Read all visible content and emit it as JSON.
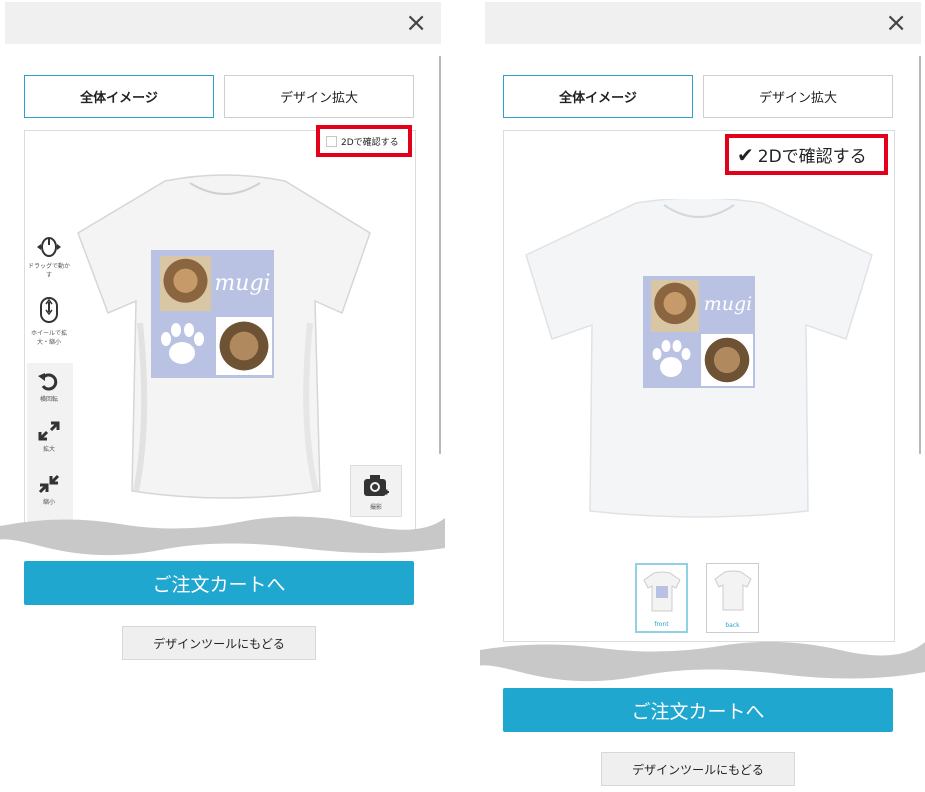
{
  "left": {
    "close_icon": "×",
    "tabs": [
      "全体イメージ",
      "デザイン拡大"
    ],
    "check_2d_label": "2Dで確認する",
    "check_2d_checked": false,
    "design_text": "mugi",
    "tools": [
      {
        "icon": "move-drag-icon",
        "label": "ドラッグで動かす"
      },
      {
        "icon": "mouse-wheel-icon",
        "label": "ホイールで拡大・縮小"
      },
      {
        "icon": "rotate-icon",
        "label": "横回転"
      },
      {
        "icon": "zoom-in-icon",
        "label": "拡大"
      },
      {
        "icon": "zoom-out-icon",
        "label": "縮小"
      }
    ],
    "camera_label": "撮影",
    "cart_button": "ご注文カートへ",
    "back_button": "デザインツールにもどる"
  },
  "right": {
    "close_icon": "×",
    "tabs": [
      "全体イメージ",
      "デザイン拡大"
    ],
    "check_2d_label": "2Dで確認する",
    "check_2d_checked": true,
    "design_text": "mugi",
    "thumbnails": [
      "front",
      "back"
    ],
    "cart_button": "ご注文カートへ",
    "back_button": "デザインツールにもどる"
  },
  "colors": {
    "accent": "#1fa7cf",
    "highlight": "#e3001a",
    "design_bg": "#b9c2e3"
  }
}
